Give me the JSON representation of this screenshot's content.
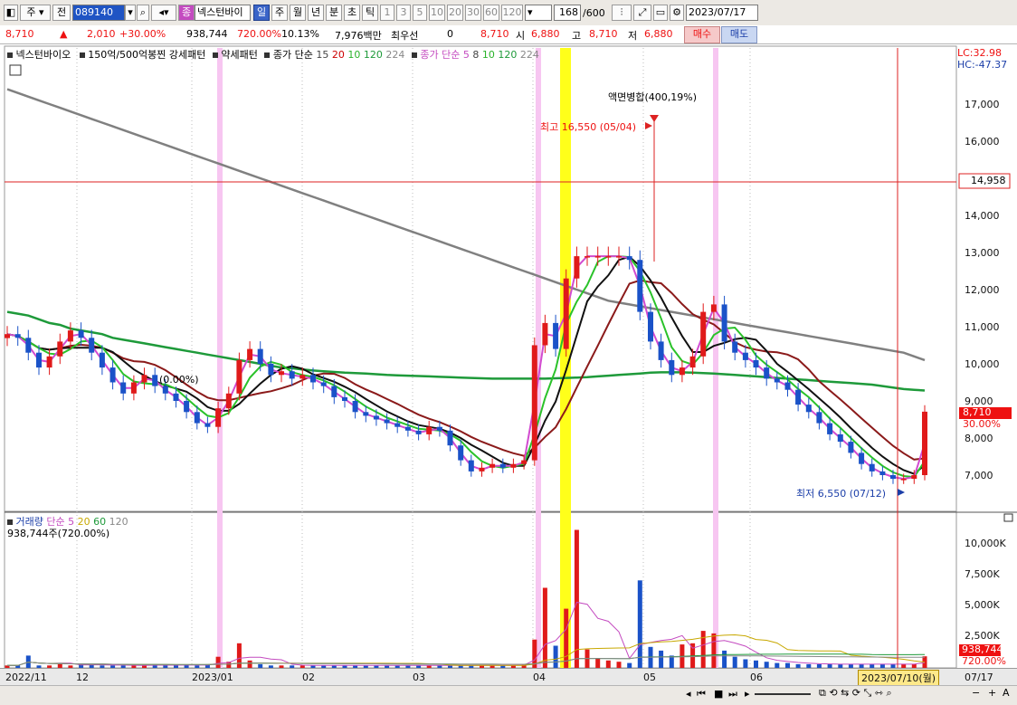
{
  "toolbar": {
    "market": "주",
    "prev": "전",
    "code": "089140",
    "name": "넥스턴바이",
    "periods": [
      "일",
      "주",
      "월",
      "년",
      "분",
      "초",
      "틱"
    ],
    "active_period": "일",
    "intervals": [
      "1",
      "3",
      "5",
      "10",
      "20",
      "30",
      "60",
      "120"
    ],
    "count": "168",
    "count_total": "/600",
    "date": "2023/07/17"
  },
  "quote": {
    "price": "8,710",
    "change": "2,010",
    "change_pct": "+30.00%",
    "volume": "938,744",
    "volume_ratio": "720.00%",
    "turnover": "10.13%",
    "amount": "7,976백만",
    "bid_label": "최우선",
    "bid": "0",
    "ask": "8,710",
    "open_label": "시",
    "open": "6,880",
    "high_label": "고",
    "high": "8,710",
    "low_label": "저",
    "low": "6,880",
    "buy": "매수",
    "sell": "매도"
  },
  "price_legend": {
    "name": "넥스턴바이오",
    "pattern": "150억/500억봉찐",
    "strong": "강세패턴",
    "weak": "약세패턴",
    "ma1_label": "종가 단순",
    "ma1_periods": [
      "15",
      "20",
      "10",
      "120",
      "224"
    ],
    "ma2_label": "종가 단순",
    "ma2_periods": [
      "5",
      "8",
      "10",
      "120",
      "224"
    ],
    "lc": "LC:32.98",
    "hc": "HC:-47.37"
  },
  "annotations": {
    "split": "액면병합(400,19%)",
    "high": "최고 16,550 (05/04)",
    "low": "최저 6,550 (07/12)",
    "small": "(0.00%)",
    "crosshair_price": "14,958",
    "last_price": "8,710",
    "last_pct": "30.00%",
    "last_volume": "938,744",
    "last_volume_pct": "720.00%",
    "crosshair_date": "2023/07/10(월)"
  },
  "volume_legend": {
    "label": "거래량",
    "type": "단순",
    "periods": [
      "5",
      "20",
      "60",
      "120"
    ],
    "value": "938,744주(720.00%)"
  },
  "x_labels": [
    "2022/11",
    "12",
    "2023/01",
    "02",
    "03",
    "04",
    "05",
    "06",
    "07/17"
  ],
  "price_ticks": [
    "17,000",
    "16,000",
    "15,000",
    "14,000",
    "13,000",
    "12,000",
    "11,000",
    "10,000",
    "9,000",
    "8,000",
    "7,000"
  ],
  "volume_ticks": [
    "10,000K",
    "7,500K",
    "5,000K",
    "2,500K"
  ],
  "chart_data": {
    "type": "line",
    "x_range": [
      "2022/11",
      "2023/07/17"
    ],
    "price_ylim": [
      6500,
      17500
    ],
    "close": [
      10800,
      10700,
      10300,
      9900,
      10200,
      10600,
      10900,
      10700,
      10300,
      9900,
      9500,
      9200,
      9500,
      9700,
      9400,
      9200,
      9000,
      8700,
      8400,
      8300,
      8800,
      9200,
      10100,
      10400,
      10000,
      9700,
      9800,
      9600,
      9700,
      9500,
      9400,
      9100,
      9000,
      8700,
      8600,
      8500,
      8400,
      8300,
      8200,
      8100,
      8300,
      8200,
      7800,
      7400,
      7100,
      7200,
      7300,
      7200,
      7300,
      7400,
      10500,
      11100,
      10400,
      12300,
      12900,
      12900,
      12900,
      12900,
      12900,
      12800,
      11400,
      10600,
      10100,
      9700,
      9900,
      10200,
      11400,
      11600,
      10600,
      10300,
      10100,
      9900,
      9600,
      9500,
      9300,
      8900,
      8700,
      8400,
      8100,
      7900,
      7600,
      7300,
      7100,
      7000,
      6900,
      6900,
      7000,
      8710
    ],
    "ma_colors": {
      "ma5": "#d24bd0",
      "ma8": "#2ac22a",
      "ma10": "#111111",
      "ma20": "#8b1a1a",
      "ma120": "#1e9a3a",
      "ma224": "#808080"
    },
    "ma120": [
      11400,
      11350,
      11300,
      11200,
      11100,
      11050,
      10950,
      10900,
      10850,
      10800,
      10700,
      10650,
      10600,
      10550,
      10500,
      10450,
      10400,
      10350,
      10300,
      10250,
      10200,
      10150,
      10100,
      10050,
      10000,
      9950,
      9900,
      9880,
      9850,
      9820,
      9800,
      9780,
      9760,
      9750,
      9740,
      9720,
      9700,
      9690,
      9680,
      9670,
      9660,
      9650,
      9640,
      9630,
      9620,
      9610,
      9600,
      9600,
      9600,
      9600,
      9600,
      9600,
      9610,
      9620,
      9630,
      9640,
      9660,
      9680,
      9700,
      9720,
      9740,
      9760,
      9770,
      9770,
      9770,
      9760,
      9750,
      9740,
      9720,
      9700,
      9680,
      9660,
      9640,
      9620,
      9600,
      9580,
      9560,
      9540,
      9520,
      9500,
      9480,
      9460,
      9440,
      9400,
      9360,
      9320,
      9300,
      9280
    ],
    "ma224": [
      17400,
      17300,
      17200,
      17100,
      17000,
      16900,
      16800,
      16700,
      16600,
      16500,
      16400,
      16300,
      16200,
      16100,
      16000,
      15900,
      15800,
      15700,
      15600,
      15500,
      15400,
      15300,
      15200,
      15100,
      15000,
      14900,
      14800,
      14700,
      14600,
      14500,
      14400,
      14300,
      14200,
      14100,
      14000,
      13900,
      13800,
      13700,
      13600,
      13500,
      13400,
      13300,
      13200,
      13100,
      13000,
      12900,
      12800,
      12700,
      12600,
      12500,
      12400,
      12300,
      12200,
      12100,
      12000,
      11900,
      11800,
      11700,
      11650,
      11600,
      11550,
      11500,
      11450,
      11400,
      11350,
      11300,
      11250,
      11200,
      11150,
      11100,
      11050,
      11000,
      10950,
      10900,
      10850,
      10800,
      10750,
      10700,
      10650,
      10600,
      10550,
      10500,
      10450,
      10400,
      10350,
      10300,
      10200,
      10100
    ],
    "volume_ylim": [
      0,
      11500
    ],
    "volume": [
      200,
      200,
      1000,
      200,
      200,
      300,
      200,
      300,
      250,
      200,
      200,
      200,
      200,
      200,
      300,
      200,
      200,
      250,
      200,
      300,
      900,
      500,
      2000,
      600,
      300,
      200,
      200,
      200,
      200,
      200,
      200,
      200,
      200,
      200,
      200,
      200,
      200,
      200,
      200,
      200,
      200,
      200,
      200,
      200,
      200,
      200,
      200,
      200,
      200,
      300,
      2300,
      6500,
      1800,
      4800,
      11200,
      1500,
      800,
      600,
      500,
      400,
      7100,
      1700,
      1400,
      1000,
      1900,
      2000,
      3000,
      2800,
      1400,
      900,
      700,
      600,
      500,
      400,
      400,
      300,
      300,
      300,
      300,
      300,
      300,
      300,
      300,
      300,
      300,
      300,
      300,
      940
    ]
  }
}
